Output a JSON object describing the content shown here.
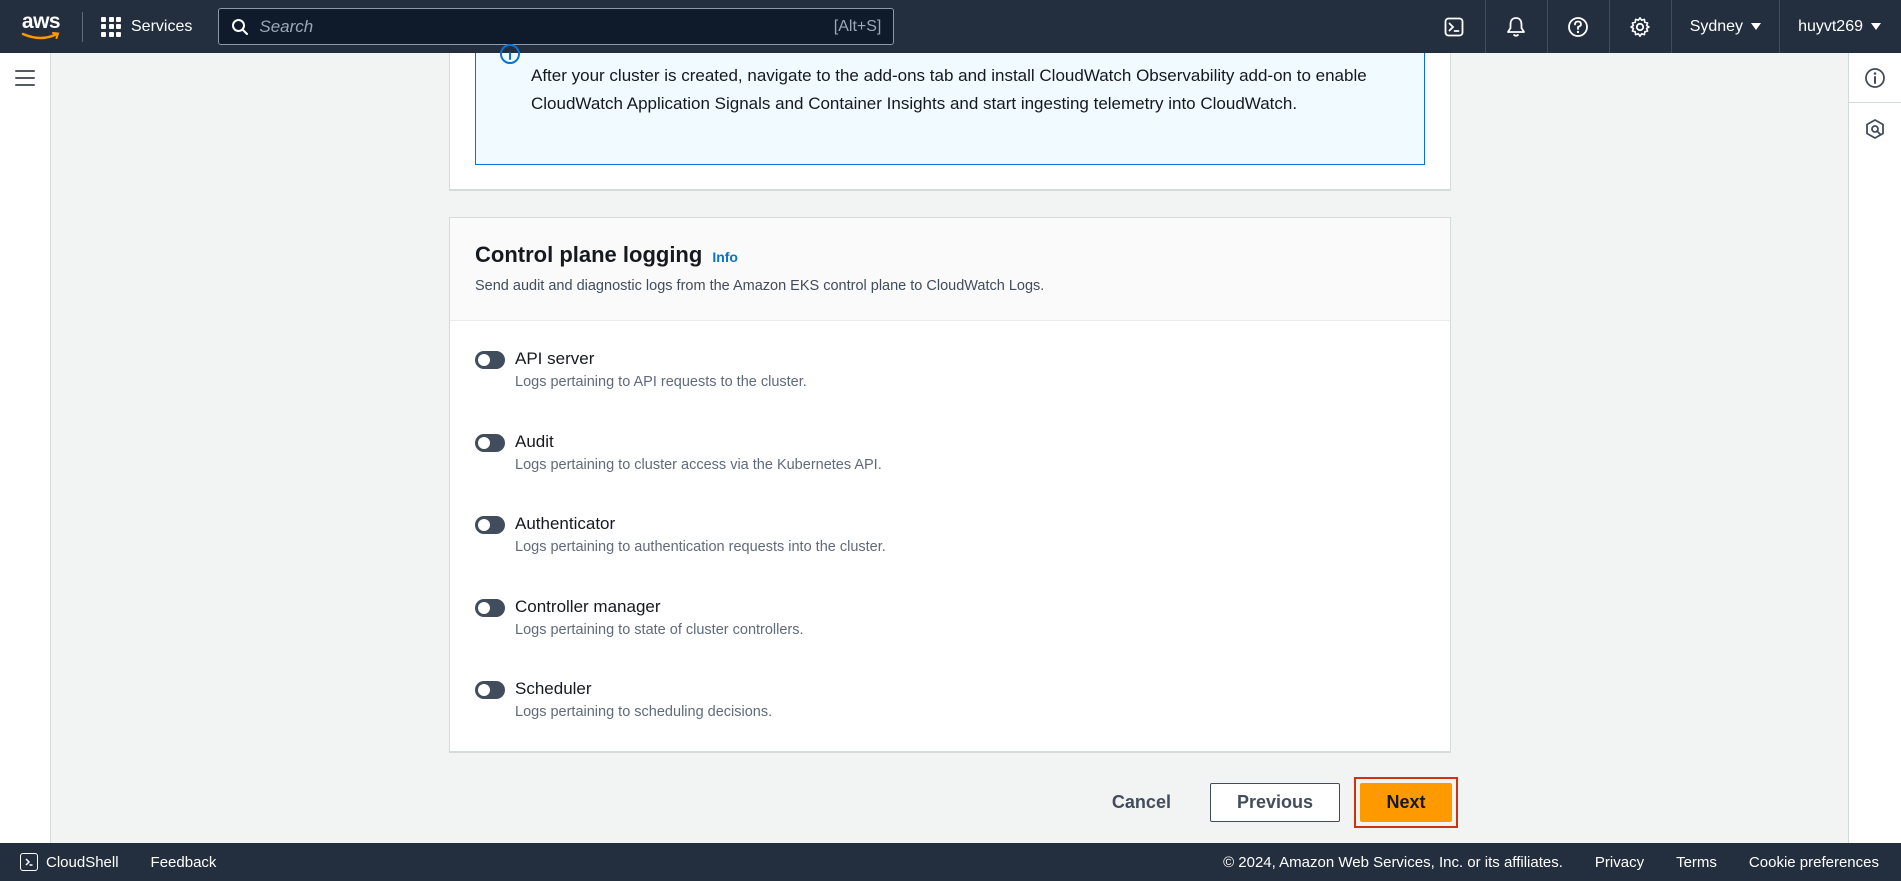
{
  "nav": {
    "logo_text": "aws",
    "services_label": "Services",
    "search_placeholder": "Search",
    "search_shortcut": "[Alt+S]",
    "region": "Sydney",
    "account": "huyvt269"
  },
  "alert": {
    "text": "After your cluster is created, navigate to the add-ons tab and install CloudWatch Observability add-on to enable CloudWatch Application Signals and Container Insights and start ingesting telemetry into CloudWatch."
  },
  "logging": {
    "title": "Control plane logging",
    "info_link": "Info",
    "description": "Send audit and diagnostic logs from the Amazon EKS control plane to CloudWatch Logs.",
    "toggles": [
      {
        "label": "API server",
        "description": "Logs pertaining to API requests to the cluster.",
        "enabled": false
      },
      {
        "label": "Audit",
        "description": "Logs pertaining to cluster access via the Kubernetes API.",
        "enabled": false
      },
      {
        "label": "Authenticator",
        "description": "Logs pertaining to authentication requests into the cluster.",
        "enabled": false
      },
      {
        "label": "Controller manager",
        "description": "Logs pertaining to state of cluster controllers.",
        "enabled": false
      },
      {
        "label": "Scheduler",
        "description": "Logs pertaining to scheduling decisions.",
        "enabled": false
      }
    ]
  },
  "actions": {
    "cancel": "Cancel",
    "previous": "Previous",
    "next": "Next"
  },
  "footer": {
    "cloudshell": "CloudShell",
    "feedback": "Feedback",
    "copyright": "© 2024, Amazon Web Services, Inc. or its affiliates.",
    "privacy": "Privacy",
    "terms": "Terms",
    "cookies": "Cookie preferences"
  },
  "colors": {
    "nav_bg": "#232f3e",
    "primary_button": "#ff9900",
    "link": "#0972d3",
    "highlight": "#d13212"
  }
}
